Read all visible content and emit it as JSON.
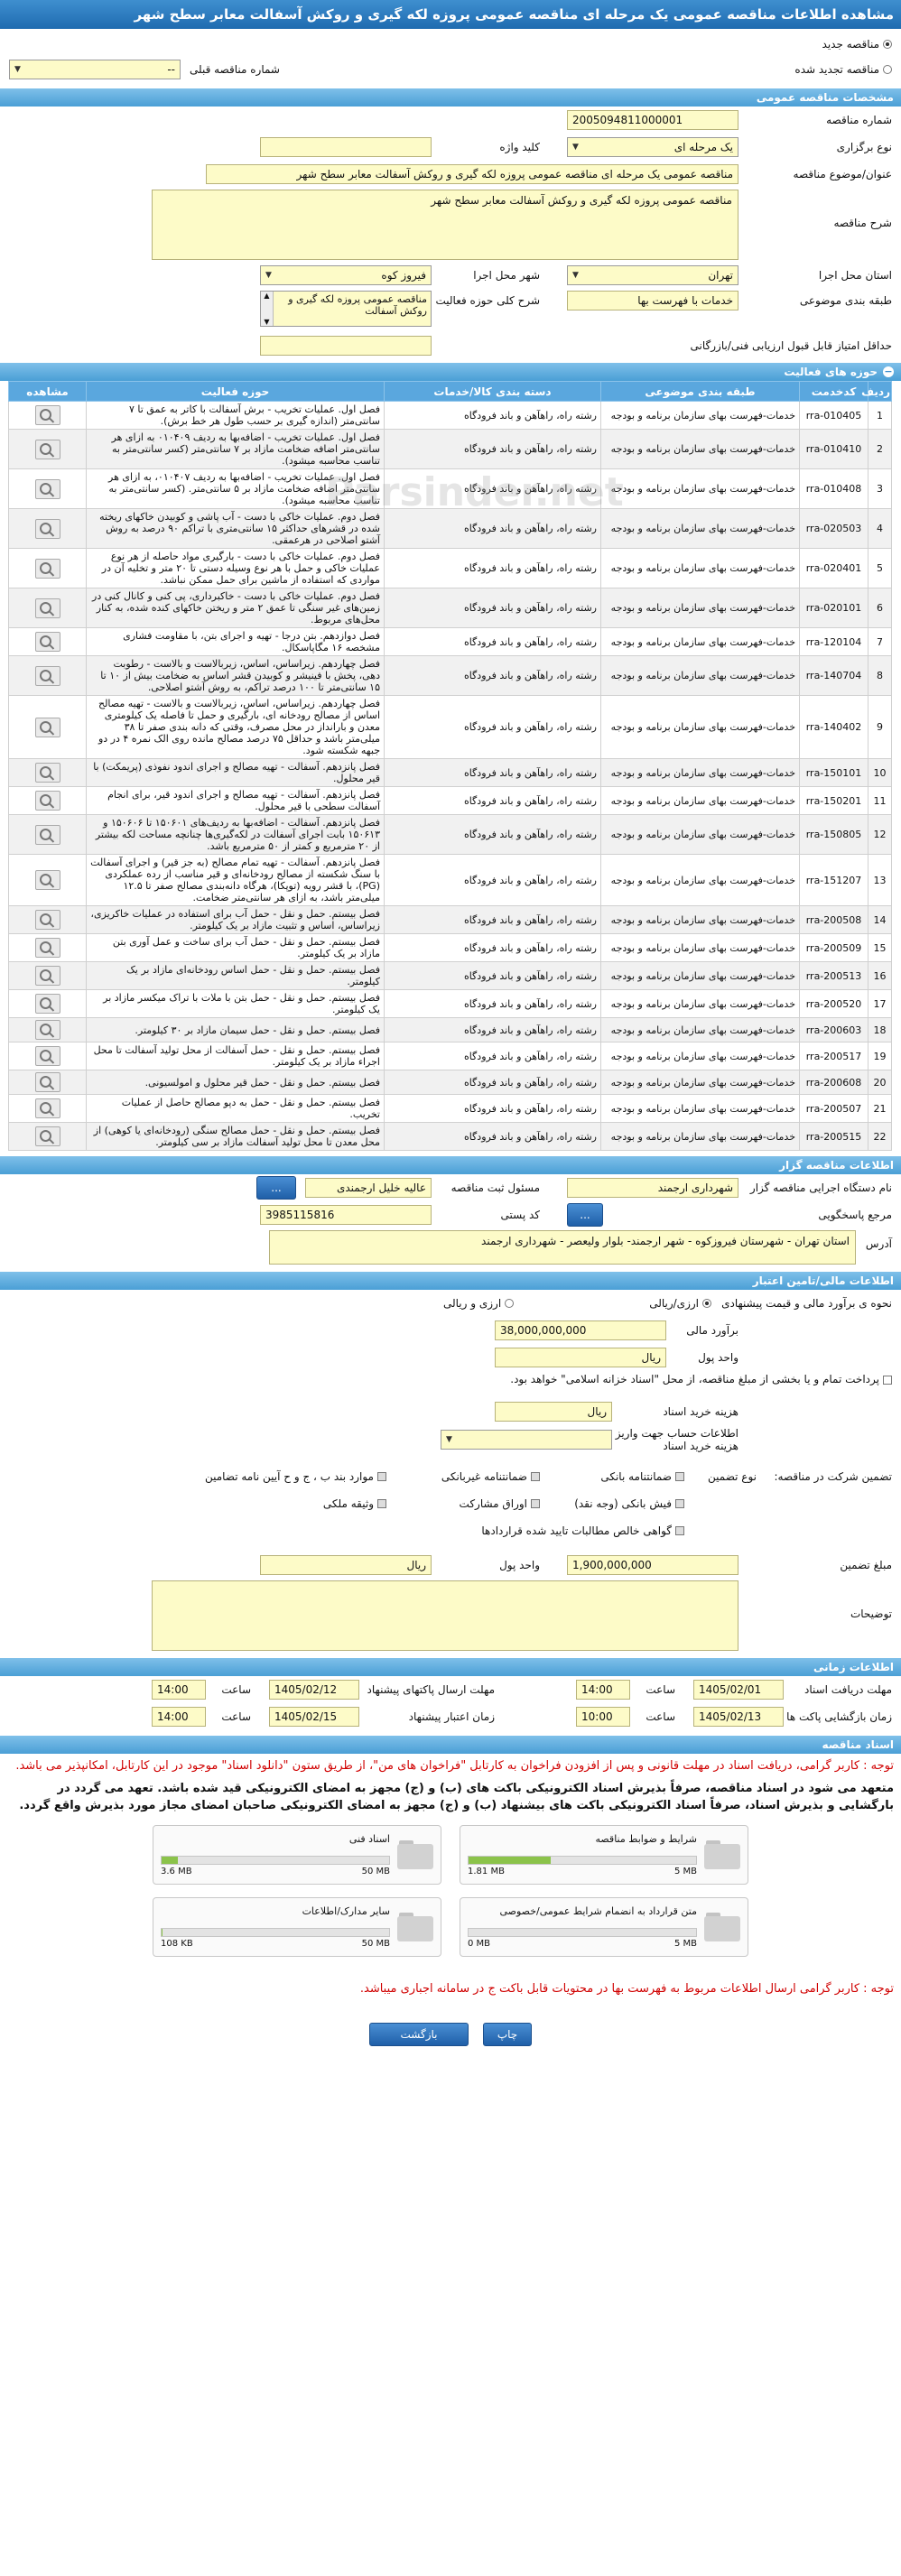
{
  "title": "مشاهده اطلاعات مناقصه عمومی یک مرحله ای مناقصه عمومی پروزه لکه گیری و روکش آسفالت معابر سطح شهر",
  "header_options": {
    "new_tender": "مناقصه جدید",
    "renewed_tender": "مناقصه تجدید شده",
    "prev_number_label": "شماره مناقصه قبلی",
    "prev_number_value": "--"
  },
  "spec": {
    "section": "مشخصات مناقصه عمومی",
    "number_label": "شماره مناقصه",
    "number_value": "2005094811000001",
    "type_label": "نوع برگزاری",
    "type_value": "یک مرحله ای",
    "keyword_label": "کلید واژه",
    "keyword_value": "",
    "subject_label": "عنوان/موضوع مناقصه",
    "subject_value": "مناقصه عمومی یک مرحله ای مناقصه عمومی پروزه لکه گیری و روکش آسفالت معابر سطح شهر",
    "desc_label": "شرح مناقصه",
    "desc_value": "مناقصه عمومی پروزه لکه گیری و روکش آسفالت معابر سطح شهر",
    "province_label": "استان محل اجرا",
    "province_value": "تهران",
    "city_label": "شهر محل اجرا",
    "city_value": "فیروز کوه",
    "category_label": "طبقه بندی موضوعی",
    "category_value": "خدمات با فهرست بها",
    "scope_label": "شرح کلی حوزه فعالیت",
    "scope_value": "مناقصه عمومی پروزه لکه گیری و روکش آسفالت",
    "min_score_label": "حداقل امتیاز قابل قبول ارزیابی فنی/بازرگانی",
    "min_score_value": ""
  },
  "activities": {
    "section": "حوزه های فعالیت",
    "columns": [
      "ردیف",
      "کدخدمت",
      "طبقه بندی موضوعی",
      "دسته بندی کالا/خدمات",
      "حوزه فعالیت",
      "مشاهده"
    ],
    "rows": [
      {
        "n": "1",
        "code": "rra-010405",
        "cat": "خدمات-فهرست بهای سازمان برنامه و بودجه",
        "group": "رشته راه، راهآهن و باند فرودگاه",
        "desc": "فصل اول. عملیات تخریب - برش آسفالت با کاتر به عمق تا ۷ سانتی‌متر (اندازه گیری بر حسب طول هر خط برش)."
      },
      {
        "n": "2",
        "code": "rra-010410",
        "cat": "خدمات-فهرست بهای سازمان برنامه و بودجه",
        "group": "رشته راه، راهآهن و باند فرودگاه",
        "desc": "فصل اول. عملیات تخریب - اضافه‌بها به ردیف ۰۱۰۴۰۹ به ازای هر سانتی‌متر اضافه ضخامت مازاد بر ۷ سانتی‌متر (کسر سانتی‌متر به تناسب محاسبه میشود)."
      },
      {
        "n": "3",
        "code": "rra-010408",
        "cat": "خدمات-فهرست بهای سازمان برنامه و بودجه",
        "group": "رشته راه، راهآهن و باند فرودگاه",
        "desc": "فصل اول. عملیات تخریب - اضافه‌بها به ردیف ۰۱۰۴۰۷، به ازای هر سانتی‌متر اضافه ضخامت مازاد بر ۵ سانتی‌متر. (کسر سانتی‌متر به تناسب محاسبه میشود)."
      },
      {
        "n": "4",
        "code": "rra-020503",
        "cat": "خدمات-فهرست بهای سازمان برنامه و بودجه",
        "group": "رشته راه، راهآهن و باند فرودگاه",
        "desc": "فصل دوم. عملیات خاکی با دست - آب پاشی و کوبیدن خاکهای ریخته شده در قشرهای حداکثر ۱۵ سانتی‌متری با تراکم ۹۰ درصد به روش آشتو اصلاحی در هرعمقی."
      },
      {
        "n": "5",
        "code": "rra-020401",
        "cat": "خدمات-فهرست بهای سازمان برنامه و بودجه",
        "group": "رشته راه، راهآهن و باند فرودگاه",
        "desc": "فصل دوم. عملیات خاکی با دست - بارگیری مواد حاصله از هر نوع عملیات خاکی و حمل با هر نوع وسیله دستی تا ۲۰ متر و تخلیه آن در مواردی که استفاده از ماشین برای حمل ممکن نباشد."
      },
      {
        "n": "6",
        "code": "rra-020101",
        "cat": "خدمات-فهرست بهای سازمان برنامه و بودجه",
        "group": "رشته راه، راهآهن و باند فرودگاه",
        "desc": "فصل دوم. عملیات خاکی با دست - خاکبرداری، پی کنی و کانال کنی در زمین‌های غیر سنگی تا عمق ۲ متر و ریختن خاکهای کنده شده، به کنار محل‌های مربوط."
      },
      {
        "n": "7",
        "code": "rra-120104",
        "cat": "خدمات-فهرست بهای سازمان برنامه و بودجه",
        "group": "رشته راه، راهآهن و باند فرودگاه",
        "desc": "فصل دوازدهم. بتن درجا - تهیه و اجرای بتن، با مقاومت فشاری مشخصه ۱۶ مگاپاسکال."
      },
      {
        "n": "8",
        "code": "rra-140704",
        "cat": "خدمات-فهرست بهای سازمان برنامه و بودجه",
        "group": "رشته راه، راهآهن و باند فرودگاه",
        "desc": "فصل چهاردهم. زیراساس، اساس، زیربالاست و بالاست - رطوبت دهی، پخش با فینیشر و کوبیدن قشر اساس به ضخامت بیش از ۱۰ تا ۱۵ سانتی‌متر تا ۱۰۰ درصد تراکم، به روش آشتو اصلاحی."
      },
      {
        "n": "9",
        "code": "rra-140402",
        "cat": "خدمات-فهرست بهای سازمان برنامه و بودجه",
        "group": "رشته راه، راهآهن و باند فرودگاه",
        "desc": "فصل چهاردهم. زیراساس، اساس، زیربالاست و بالاست - تهیه مصالح اساس از مصالح رودخانه ای، بارگیری و حمل تا فاصله یک کیلومتری معدن و بارانداز در محل مصرف، وقتی که دانه بندی صفر تا ۳۸ میلی‌متر باشد و حداقل ۷۵ درصد مصالح مانده روی الک نمره ۴ در دو جبهه شکسته شود."
      },
      {
        "n": "10",
        "code": "rra-150101",
        "cat": "خدمات-فهرست بهای سازمان برنامه و بودجه",
        "group": "رشته راه، راهآهن و باند فرودگاه",
        "desc": "فصل پانزدهم. آسفالت - تهیه مصالح و اجرای اندود نفوذی (پریمکت) با قیر محلول."
      },
      {
        "n": "11",
        "code": "rra-150201",
        "cat": "خدمات-فهرست بهای سازمان برنامه و بودجه",
        "group": "رشته راه، راهآهن و باند فرودگاه",
        "desc": "فصل پانزدهم. آسفالت - تهیه مصالح و اجرای اندود قیر، برای انجام آسفالت سطحی با قیر محلول."
      },
      {
        "n": "12",
        "code": "rra-150805",
        "cat": "خدمات-فهرست بهای سازمان برنامه و بودجه",
        "group": "رشته راه، راهآهن و باند فرودگاه",
        "desc": "فصل پانزدهم. آسفالت - اضافه‌بها به ردیف‌های ۱۵۰۶۰۱ تا ۱۵۰۶۰۶ و ۱۵۰۶۱۳ بابت اجرای آسفالت در لکه‌گیری‌ها چنانچه مساحت لکه بیشتر از ۲۰ مترمربع و کمتر از ۵۰ مترمربع باشد."
      },
      {
        "n": "13",
        "code": "rra-151207",
        "cat": "خدمات-فهرست بهای سازمان برنامه و بودجه",
        "group": "رشته راه، راهآهن و باند فرودگاه",
        "desc": "فصل پانزدهم. آسفالت - تهیه تمام مصالح (به جز قیر) و اجرای آسفالت با سنگ شکسته از مصالح رودخانه‌ای و قیر مناسب از رده عملکردی (PG)، با قشر رویه (توپکا)، هرگاه دانه‌بندی مصالح صفر تا ۱۲.۵ میلی‌متر باشد، به ازای هر سانتی‌متر ضخامت."
      },
      {
        "n": "14",
        "code": "rra-200508",
        "cat": "خدمات-فهرست بهای سازمان برنامه و بودجه",
        "group": "رشته راه، راهآهن و باند فرودگاه",
        "desc": "فصل بیستم. حمل و نقل - حمل آب برای استفاده در عملیات خاکریزی، زیراساس، اساس و تثبیت مازاد بر یک کیلومتر."
      },
      {
        "n": "15",
        "code": "rra-200509",
        "cat": "خدمات-فهرست بهای سازمان برنامه و بودجه",
        "group": "رشته راه، راهآهن و باند فرودگاه",
        "desc": "فصل بیستم. حمل و نقل - حمل آب برای ساخت و عمل آوری بتن مازاد بر یک کیلومتر."
      },
      {
        "n": "16",
        "code": "rra-200513",
        "cat": "خدمات-فهرست بهای سازمان برنامه و بودجه",
        "group": "رشته راه، راهآهن و باند فرودگاه",
        "desc": "فصل بیستم. حمل و نقل - حمل اساس رودخانه‌ای مازاد بر یک کیلومتر."
      },
      {
        "n": "17",
        "code": "rra-200520",
        "cat": "خدمات-فهرست بهای سازمان برنامه و بودجه",
        "group": "رشته راه، راهآهن و باند فرودگاه",
        "desc": "فصل بیستم. حمل و نقل - حمل بتن با ملات با تراک میکسر مازاد بر یک کیلومتر."
      },
      {
        "n": "18",
        "code": "rra-200603",
        "cat": "خدمات-فهرست بهای سازمان برنامه و بودجه",
        "group": "رشته راه، راهآهن و باند فرودگاه",
        "desc": "فصل بیستم. حمل و نقل - حمل سیمان مازاد بر ۳۰ کیلومتر."
      },
      {
        "n": "19",
        "code": "rra-200517",
        "cat": "خدمات-فهرست بهای سازمان برنامه و بودجه",
        "group": "رشته راه، راهآهن و باند فرودگاه",
        "desc": "فصل بیستم. حمل و نقل - حمل آسفالت از محل تولید آسفالت تا محل اجراء مازاد بر یک کیلومتر."
      },
      {
        "n": "20",
        "code": "rra-200608",
        "cat": "خدمات-فهرست بهای سازمان برنامه و بودجه",
        "group": "رشته راه، راهآهن و باند فرودگاه",
        "desc": "فصل بیستم. حمل و نقل - حمل قیر محلول و امولسیونی."
      },
      {
        "n": "21",
        "code": "rra-200507",
        "cat": "خدمات-فهرست بهای سازمان برنامه و بودجه",
        "group": "رشته راه، راهآهن و باند فرودگاه",
        "desc": "فصل بیستم. حمل و نقل - حمل به دپو مصالح حاصل از عملیات تخریب."
      },
      {
        "n": "22",
        "code": "rra-200515",
        "cat": "خدمات-فهرست بهای سازمان برنامه و بودجه",
        "group": "رشته راه، راهآهن و باند فرودگاه",
        "desc": "فصل بیستم. حمل و نقل - حمل مصالح سنگی (رودخانه‌ای یا کوهی) از محل معدن تا محل تولید آسفالت مازاد بر سی کیلومتر."
      }
    ]
  },
  "organizer": {
    "section": "اطلاعات مناقصه گزار",
    "org_label": "نام دستگاه اجرایی مناقصه گزار",
    "org_value": "شهرداری ارجمند",
    "official_label": "مسئول ثبت مناقصه",
    "official_value": "عالیه خلیل ارجمندی",
    "more_btn": "...",
    "ref_label": "مرجع پاسخگویی",
    "ref_btn": "...",
    "postal_label": "کد پستی",
    "postal_value": "3985115816",
    "address_label": "آدرس",
    "address_value": "استان تهران - شهرستان فیروزکوه - شهر ارجمند- بلوار ولیعصر - شهرداری ارجمند"
  },
  "finance": {
    "section": "اطلاعات مالی/تامین اعتبار",
    "estimate_method_label": "نحوه ی برآورد مالی و قیمت پیشنهادی",
    "opt_rial": "ارزی/ریالی",
    "opt_currency": "ارزی و ریالی",
    "estimate_label": "برآورد مالی",
    "estimate_value": "38,000,000,000",
    "unit_label": "واحد پول",
    "unit_value": "ریال",
    "treasury_text": "پرداخت تمام و یا بخشی از مبلغ مناقصه، از محل \"اسناد خزانه اسلامی\" خواهد بود.",
    "doc_fee_label": "هزینه خرید اسناد",
    "doc_fee_unit": "ریال",
    "account_label": "اطلاعات حساب جهت واریز هزینه خرید اسناد",
    "guarantee_type_label": "نوع تضمین",
    "participation_label": "تضمین شرکت در مناقصه:",
    "guarantees": [
      "ضمانتنامه بانکی",
      "ضمانتنامه غیربانکی",
      "موارد بند ب ، ج و ح آیین نامه تضامین",
      "فیش بانکی (وجه نقد)",
      "اوراق مشارکت",
      "وثیقه ملکی",
      "گواهی خالص مطالبات تایید شده قراردادها"
    ],
    "guarantee_amount_label": "مبلغ تضمین",
    "guarantee_amount_value": "1,900,000,000",
    "guarantee_unit_label": "واحد پول",
    "guarantee_unit_value": "ریال",
    "notes_label": "توضیحات",
    "notes_value": ""
  },
  "timing": {
    "section": "اطلاعات زمانی",
    "receive_deadline_label": "مهلت دریافت اسناد",
    "receive_deadline_date": "1405/02/01",
    "receive_deadline_time": "14:00",
    "send_deadline_label": "مهلت ارسال پاکتهای پیشنهاد",
    "send_deadline_date": "1405/02/12",
    "send_deadline_time": "14:00",
    "open_label": "زمان بازگشایی پاکت ها",
    "open_date": "1405/02/13",
    "open_time": "10:00",
    "valid_label": "زمان اعتبار پیشنهاد",
    "valid_date": "1405/02/15",
    "valid_time": "14:00",
    "time_label": "ساعت"
  },
  "documents": {
    "section": "اسناد مناقصه",
    "note_red": "توجه : کاربر گرامی، دریافت اسناد در مهلت قانونی و پس از افزودن فراخوان به کارتابل \"فراخوان های من\"، از طریق ستون \"دانلود اسناد\" موجود در این کارتابل، امکانپذیر می باشد.",
    "note_bold": "متعهد می شود در اسناد مناقصه، صرفاً بذیرش اسناد الکترونیکی باکت های (ب) و (ج) مجهز به امضای الکترونیکی قید شده باشد. تعهد می گردد در بارگشایی و بذیرش اسناد، صرفاً اسناد الکترونیکی باکت های بیشنهاد (ب) و (ج) مجهز به امضای الکترونیکی صاحبان امضای مجاز مورد بذیرش واقع گردد.",
    "files": [
      {
        "title": "شرایط و ضوابط مناقصه",
        "used": "1.81 MB",
        "total": "5 MB",
        "fraction": 0.36
      },
      {
        "title": "اسناد فنی",
        "used": "3.6 MB",
        "total": "50 MB",
        "fraction": 0.07
      },
      {
        "title": "متن قرارداد به انضمام شرایط عمومی/خصوصی",
        "used": "0 MB",
        "total": "5 MB",
        "fraction": 0
      },
      {
        "title": "سایر مدارک/اطلاعات",
        "used": "108 KB",
        "total": "50 MB",
        "fraction": 0.002
      }
    ],
    "note_bottom": "توجه : کاربر گرامی ارسال اطلاعات مربوط به فهرست بها در محتویات قابل باکت ج در سامانه اجباری میباشد."
  },
  "buttons": {
    "print": "چاپ",
    "back": "بازگشت"
  },
  "watermark": "Parsinder.net"
}
